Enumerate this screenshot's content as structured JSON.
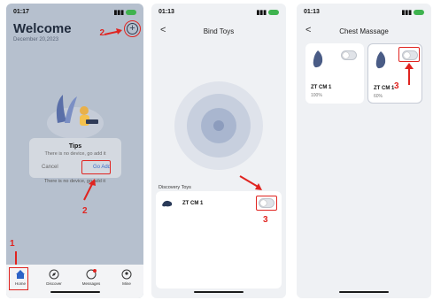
{
  "screen1": {
    "time": "01:17",
    "title": "Welcome",
    "date": "December 20,2023",
    "dialog": {
      "title": "Tips",
      "message": "There is no device, go add it",
      "cancel": "Cancel",
      "confirm": "Go Add"
    },
    "empty_message": "There is no device, go add it",
    "tabs": [
      "Home",
      "Discover",
      "Messages",
      "Mine"
    ],
    "steps": {
      "home": "1",
      "plus": "2",
      "go_add": "2"
    }
  },
  "screen2": {
    "time": "01:13",
    "title": "Bind Toys",
    "section": "Discovery Toys",
    "device": "ZT CM 1",
    "step": "3"
  },
  "screen3": {
    "time": "01:13",
    "title": "Chest Massage",
    "devices": [
      {
        "name": "ZT CM 1",
        "battery": "100%"
      },
      {
        "name": "ZT CM 1",
        "battery": "60%"
      }
    ],
    "step": "3"
  },
  "colors": {
    "annotation": "#e02420",
    "accent": "#3a6cc9",
    "battery": "#3fb34f"
  }
}
